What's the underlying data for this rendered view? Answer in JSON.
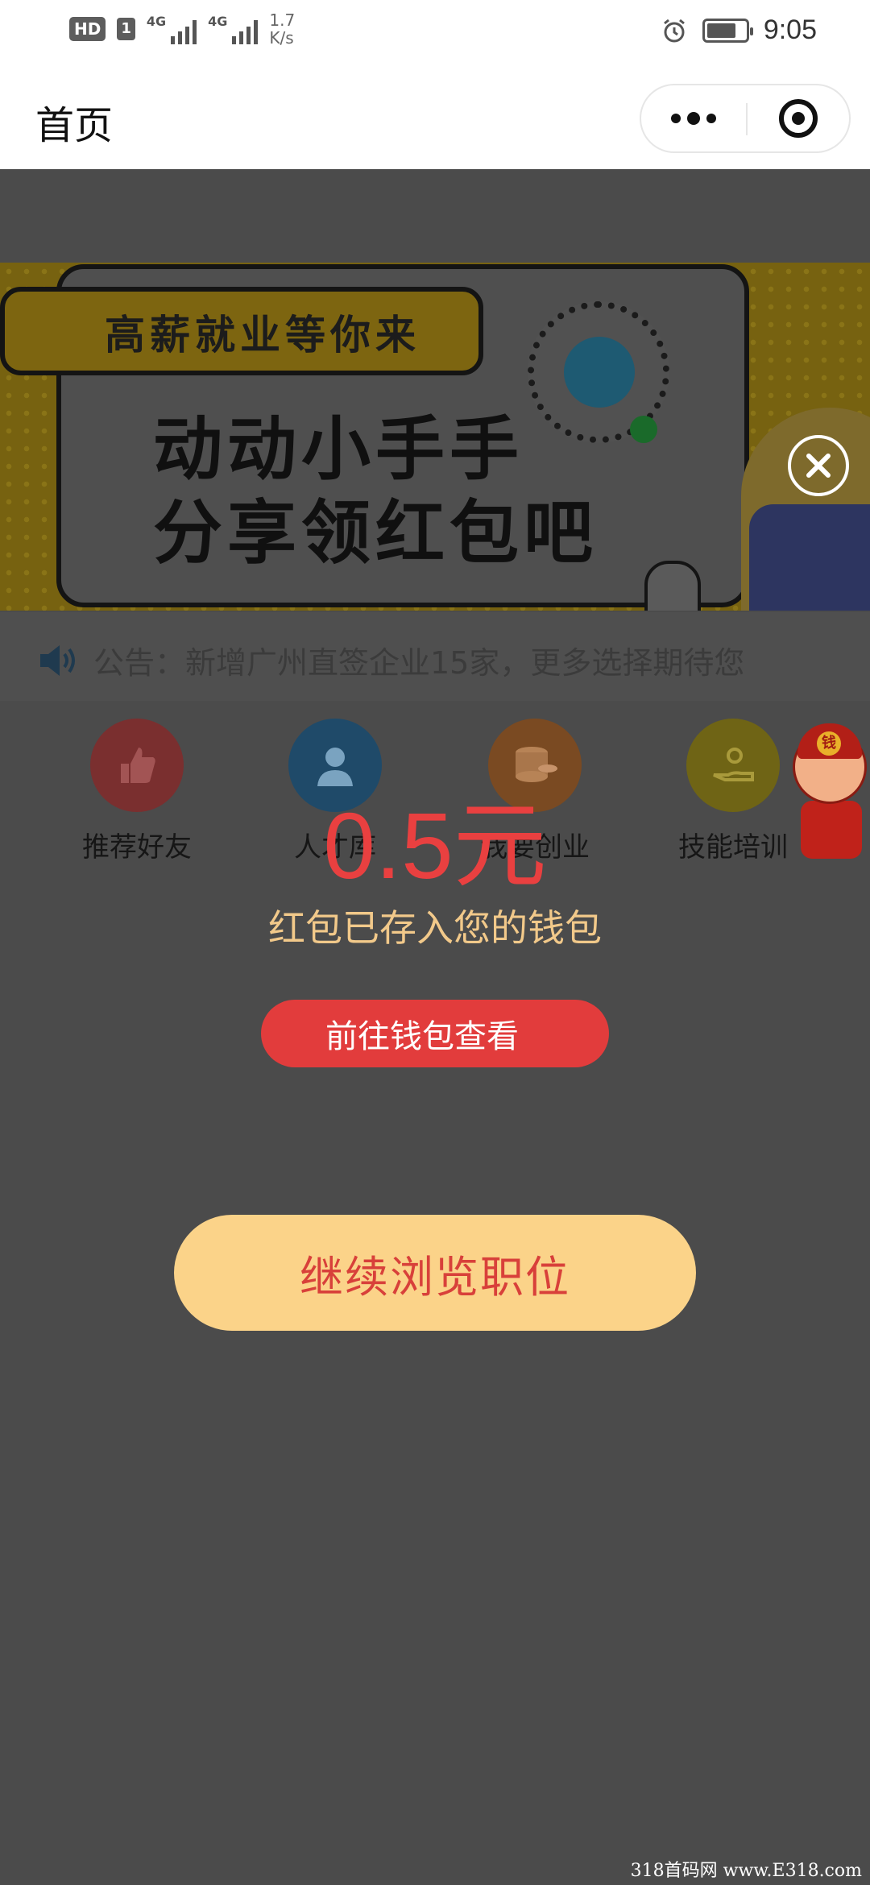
{
  "status_bar": {
    "hd": "HD",
    "sim": "1",
    "net1": "4G",
    "net2": "4G",
    "speed_value": "1.7",
    "speed_unit": "K/s",
    "time": "9:05",
    "battery_level": 0.75
  },
  "nav": {
    "title": "首页"
  },
  "banner": {
    "tag": "高薪就业等你来",
    "headline_line1": "动动小手手",
    "headline_line2": "分享领红包吧"
  },
  "notice": {
    "text": "公告：新增广州直签企业15家，更多选择期待您"
  },
  "grid": [
    {
      "label": "推荐好友",
      "icon": "thumbs-up-icon",
      "color": "#7a2f2f"
    },
    {
      "label": "人才库",
      "icon": "person-icon",
      "color": "#1f4a69"
    },
    {
      "label": "我要创业",
      "icon": "coins-icon",
      "color": "#7a4a22"
    },
    {
      "label": "技能培训",
      "icon": "gear-hand-icon",
      "color": "#6f6415"
    }
  ],
  "mascot": {
    "coin_char": "钱"
  },
  "popup": {
    "amount": "0.5元",
    "saved_text": "红包已存入您的钱包",
    "wallet_button": "前往钱包查看",
    "continue_button": "继续浏览职位"
  },
  "watermark": "318首码网  www.E318.com",
  "colors": {
    "overlay_bg": "#4b4b4b",
    "amount": "#e94040",
    "saved_text": "#f2c98a",
    "wallet_button": "#e23c3c",
    "continue_button": "#fbd389",
    "continue_text": "#d8403a"
  }
}
